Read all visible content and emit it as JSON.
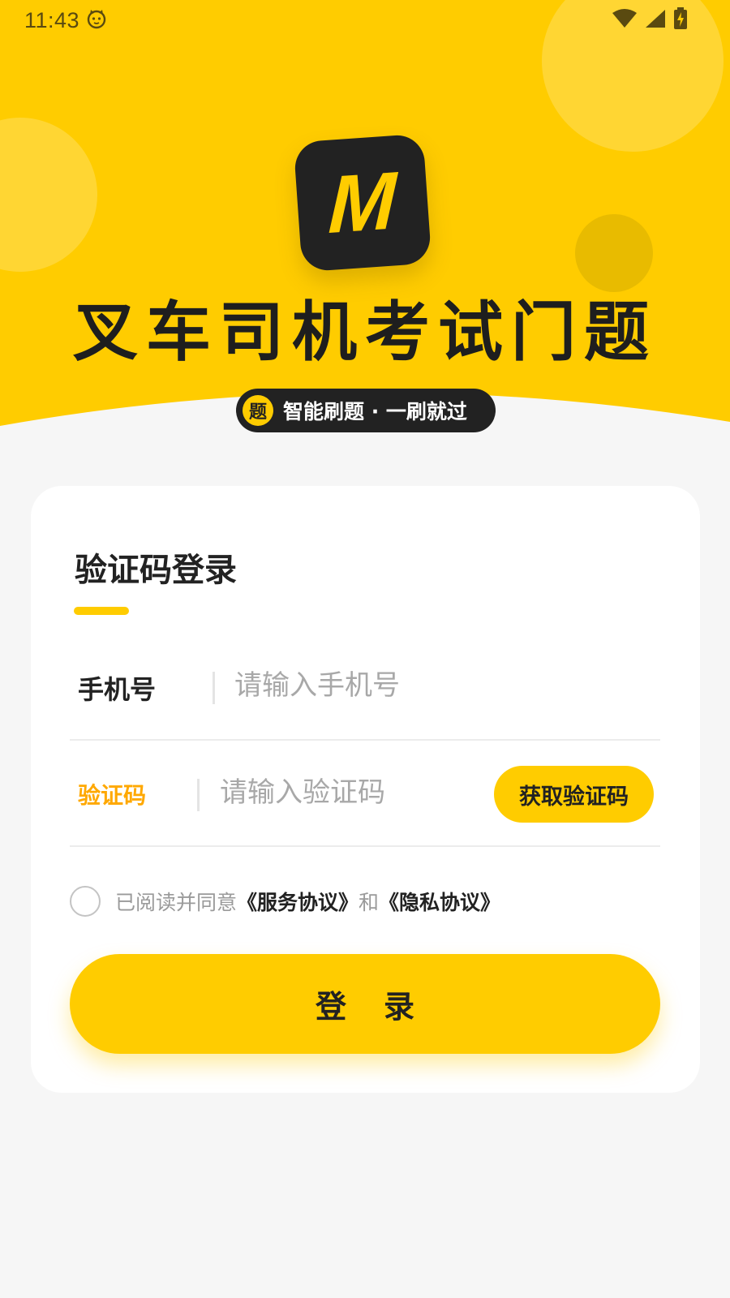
{
  "status_bar": {
    "time": "11:43",
    "notification_icon": "cat-face-icon",
    "wifi_icon": "wifi-icon",
    "signal_icon": "cellular-signal-icon",
    "battery_icon": "battery-charging-icon"
  },
  "header": {
    "logo_letter": "M",
    "app_title": "叉车司机考试门题",
    "slogan_icon_text": "题",
    "slogan": "智能刷题 · 一刷就过"
  },
  "login_card": {
    "title": "验证码登录",
    "phone": {
      "label": "手机号",
      "placeholder": "请输入手机号",
      "value": ""
    },
    "code": {
      "label": "验证码",
      "placeholder": "请输入验证码",
      "value": "",
      "get_code_label": "获取验证码"
    },
    "agreement": {
      "prefix": "已阅读并同意",
      "service_link": "《服务协议》",
      "conjunction": "和",
      "privacy_link": "《隐私协议》",
      "checked": false
    },
    "login_label": "登录"
  },
  "colors": {
    "brand_yellow": "#ffcc00",
    "dark": "#222222",
    "accent_orange": "#ffa800",
    "background": "#f6f6f6"
  }
}
